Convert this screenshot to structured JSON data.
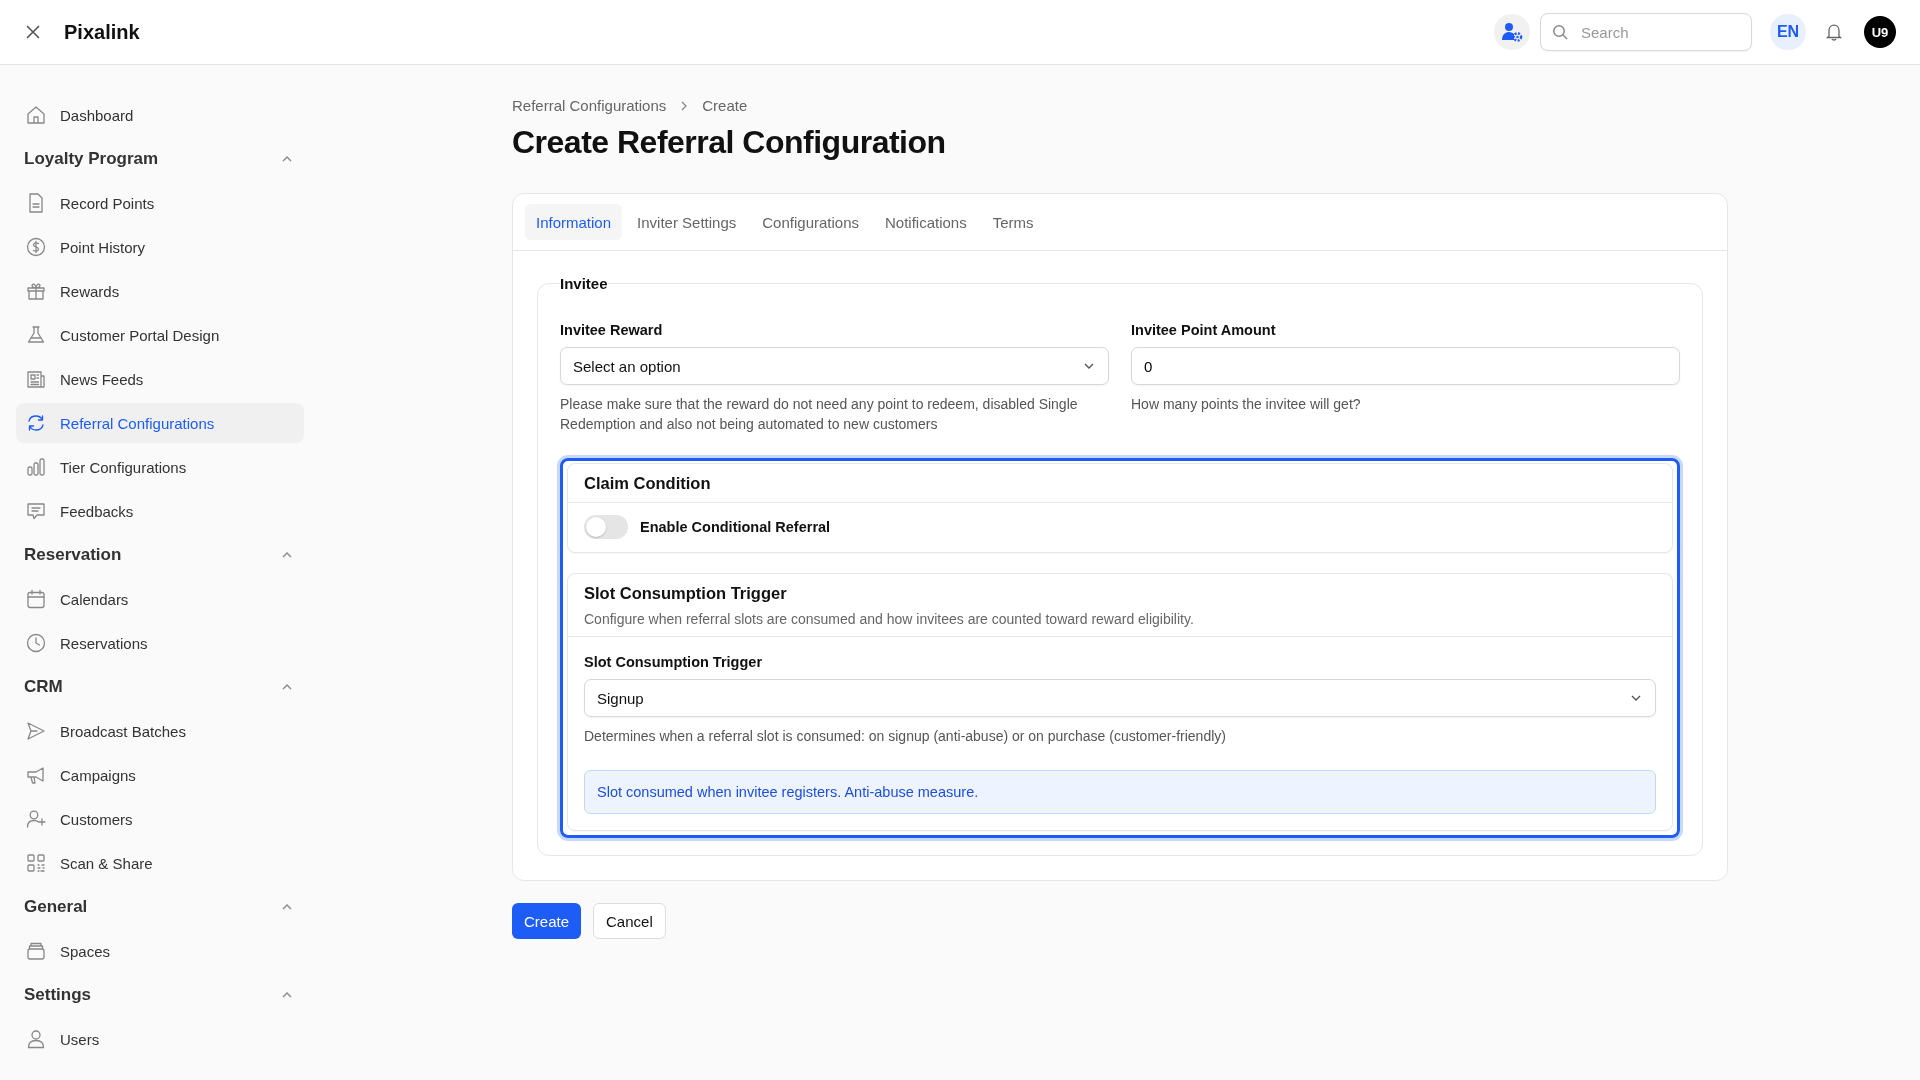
{
  "topbar": {
    "brand": "Pixalink",
    "search": {
      "placeholder": "Search"
    },
    "language": "EN",
    "avatar": "U9"
  },
  "sidebar": {
    "top_items": [
      {
        "label": "Dashboard",
        "selected": false
      }
    ],
    "groups": [
      {
        "title": "Loyalty Program",
        "expanded": true,
        "items": [
          {
            "label": "Record Points",
            "selected": false
          },
          {
            "label": "Point History",
            "selected": false
          },
          {
            "label": "Rewards",
            "selected": false
          },
          {
            "label": "Customer Portal Design",
            "selected": false
          },
          {
            "label": "News Feeds",
            "selected": false
          },
          {
            "label": "Referral Configurations",
            "selected": true
          },
          {
            "label": "Tier Configurations",
            "selected": false
          },
          {
            "label": "Feedbacks",
            "selected": false
          }
        ]
      },
      {
        "title": "Reservation",
        "expanded": true,
        "items": [
          {
            "label": "Calendars",
            "selected": false
          },
          {
            "label": "Reservations",
            "selected": false
          }
        ]
      },
      {
        "title": "CRM",
        "expanded": true,
        "items": [
          {
            "label": "Broadcast Batches",
            "selected": false
          },
          {
            "label": "Campaigns",
            "selected": false
          },
          {
            "label": "Customers",
            "selected": false
          },
          {
            "label": "Scan & Share",
            "selected": false
          }
        ]
      },
      {
        "title": "General",
        "expanded": true,
        "items": [
          {
            "label": "Spaces",
            "selected": false
          }
        ]
      },
      {
        "title": "Settings",
        "expanded": true,
        "items": [
          {
            "label": "Users",
            "selected": false
          }
        ]
      }
    ]
  },
  "breadcrumb": [
    "Referral Configurations",
    "Create"
  ],
  "title": "Create Referral Configuration",
  "tabs": [
    {
      "label": "Information",
      "selected": true
    },
    {
      "label": "Inviter Settings",
      "selected": false
    },
    {
      "label": "Configurations",
      "selected": false
    },
    {
      "label": "Notifications",
      "selected": false
    },
    {
      "label": "Terms",
      "selected": false
    }
  ],
  "invitee": {
    "legend": "Invitee",
    "reward": {
      "label": "Invitee Reward",
      "value": "Select an option",
      "help": "Please make sure that the reward do not need any point to redeem, disabled Single Redemption and also not being automated to new customers"
    },
    "point_amount": {
      "label": "Invitee Point Amount",
      "value": "0",
      "help": "How many points the invitee will get?"
    },
    "rules_focused": true,
    "claim_condition": {
      "title": "Claim Condition",
      "toggle": {
        "label": "Enable Conditional Referral",
        "on": false
      }
    },
    "slot_trigger": {
      "title": "Slot Consumption Trigger",
      "description": "Configure when referral slots are consumed and how invitees are counted toward reward eligibility.",
      "field": {
        "label": "Slot Consumption Trigger",
        "value": "Signup",
        "help": "Determines when a referral slot is consumed: on signup (anti-abuse) or on purchase (customer-friendly)"
      },
      "info": "Slot consumed when invitee registers. Anti-abuse measure."
    }
  },
  "buttons": [
    {
      "label": "Create",
      "kind": "primary"
    },
    {
      "label": "Cancel",
      "kind": "secondary"
    }
  ]
}
